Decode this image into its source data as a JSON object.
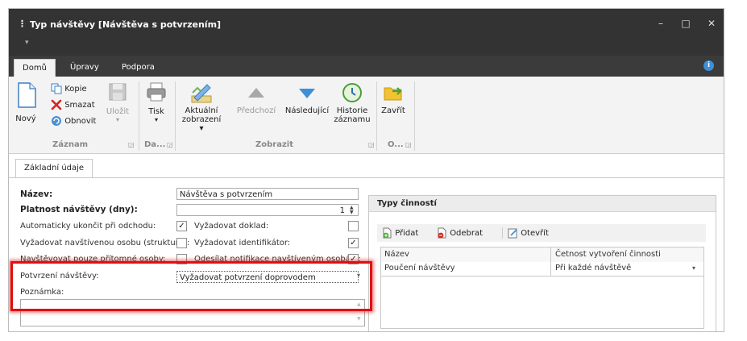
{
  "window": {
    "title": "Typ návštěvy [Návštěva s potvrzením]",
    "sub_indicator": "▾",
    "minimize_glyph": "–",
    "maximize_glyph": "□",
    "close_glyph": "✕",
    "info_glyph": "i"
  },
  "ribbon_tabs": [
    "Domů",
    "Úpravy",
    "Podpora"
  ],
  "ribbon": {
    "new": "Nový",
    "copy": "Kopie",
    "delete": "Smazat",
    "refresh": "Obnovit",
    "save": "Uložit",
    "print": "Tisk",
    "current_view": [
      "Aktuální",
      "zobrazení ▾"
    ],
    "previous": "Předchozí",
    "next": "Následující",
    "history": [
      "Historie",
      "záznamu"
    ],
    "close": "Zavřít",
    "groups": [
      "Záznam",
      "Da...",
      "Zobrazit",
      "O..."
    ],
    "launcher_glyph": "◲",
    "dropdown_glyph": "▾"
  },
  "doc_tab": "Základní údaje",
  "form": {
    "name_label": "Název:",
    "name_value": "Návštěva s potvrzením",
    "validity_label": "Platnost návštěvy (dny):",
    "validity_value": "1",
    "auto_end_label": "Automaticky ukončit při odchodu:",
    "require_doc_label": "Vyžadovat doklad:",
    "require_person_label": "Vyžadovat navštívenou osobu (strukturu):",
    "require_id_label": "Vyžadovat identifikátor:",
    "present_only_label": "Navštěvovat pouze přítomné osoby:",
    "send_notif_label": "Odesílat notifikace navštíveným osobám:",
    "confirm_label": "Potvrzení návštěvy:",
    "confirm_value": "Vyžadovat potvrzení doprovodem",
    "note_label": "Poznámka:",
    "check_glyph": "✓",
    "checks": {
      "auto_end": true,
      "require_doc": false,
      "require_person": false,
      "require_id": true,
      "present_only": false,
      "send_notif": true
    }
  },
  "activities": {
    "title": "Typy činností",
    "add": "Přidat",
    "remove": "Odebrat",
    "open": "Otevřít",
    "columns": [
      "Název",
      "Četnost vytvoření činnosti"
    ],
    "rows": [
      {
        "name": "Poučení návštěvy",
        "frequency": "Při každé návštěvě"
      }
    ]
  },
  "colors": {
    "titlebar": "#333333",
    "highlight": "#e01010"
  },
  "icons": [
    "new-document-icon",
    "copy-icon",
    "delete-icon",
    "refresh-icon",
    "save-icon",
    "print-icon",
    "view-icon",
    "previous-icon",
    "next-icon",
    "history-icon",
    "close-folder-icon",
    "add-icon",
    "remove-icon",
    "open-icon"
  ]
}
